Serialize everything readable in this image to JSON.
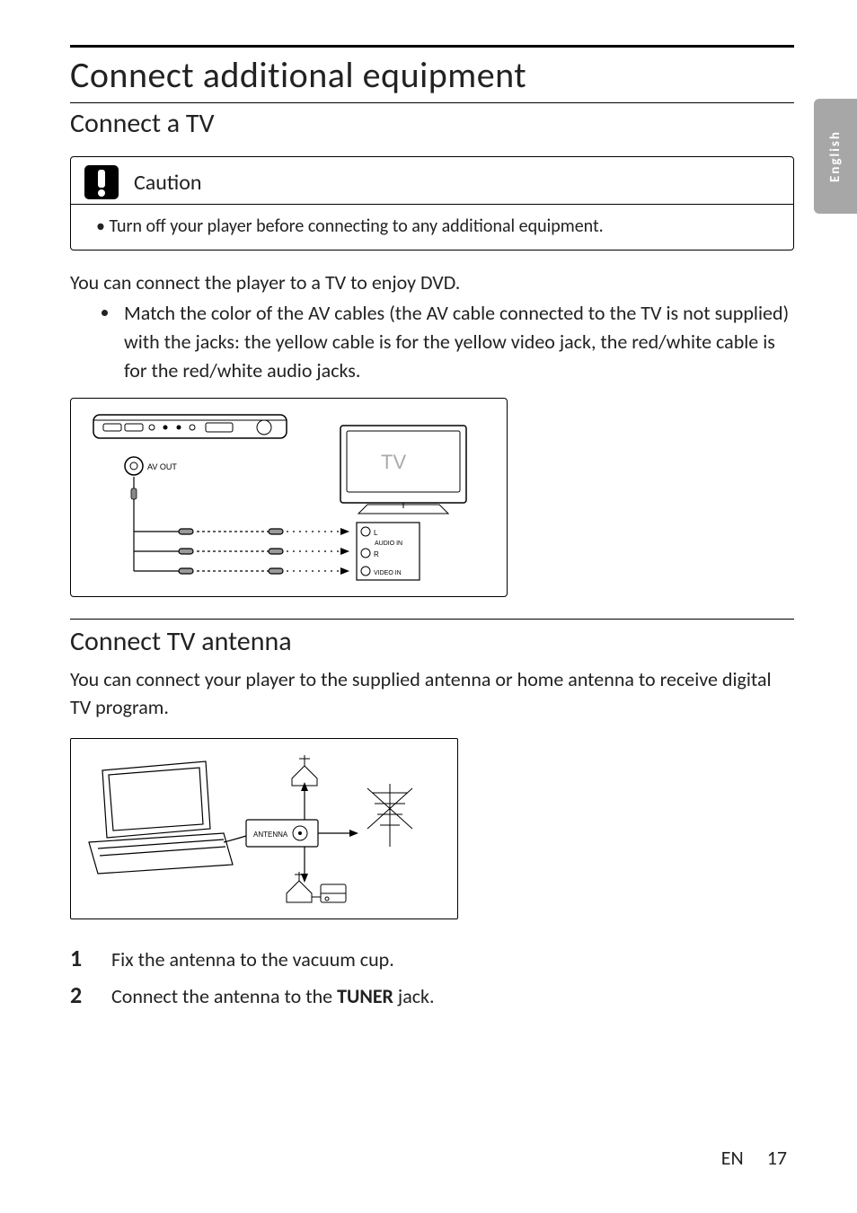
{
  "side_tab": "English",
  "h1": "Connect additional equipment",
  "sectionA": {
    "heading": "Connect a TV",
    "caution_title": "Caution",
    "caution_body": "Turn off your player before connecting to any additional equipment.",
    "intro": "You can connect the player to a TV to enjoy DVD.",
    "bullet": "Match the color of the AV cables (the AV cable connected to the TV is not supplied) with the jacks: the yellow cable is for the yellow video jack, the red/white cable is for the red/white audio jacks.",
    "diagram_labels": {
      "av_out": "AV OUT",
      "tv": "TV",
      "audio_in": "AUDIO IN",
      "video_in": "VIDEO IN",
      "l": "L",
      "r": "R"
    }
  },
  "sectionB": {
    "heading": "Connect TV antenna",
    "intro": "You can connect your player to the supplied antenna or home antenna to receive digital TV program.",
    "diagram_labels": {
      "antenna": "ANTENNA"
    },
    "steps": [
      {
        "text_pre": "Fix the antenna to the vacuum cup."
      },
      {
        "text_pre": "Connect the antenna to the ",
        "bold": "TUNER",
        "text_post": " jack."
      }
    ]
  },
  "footer": {
    "lang": "EN",
    "page": "17"
  }
}
